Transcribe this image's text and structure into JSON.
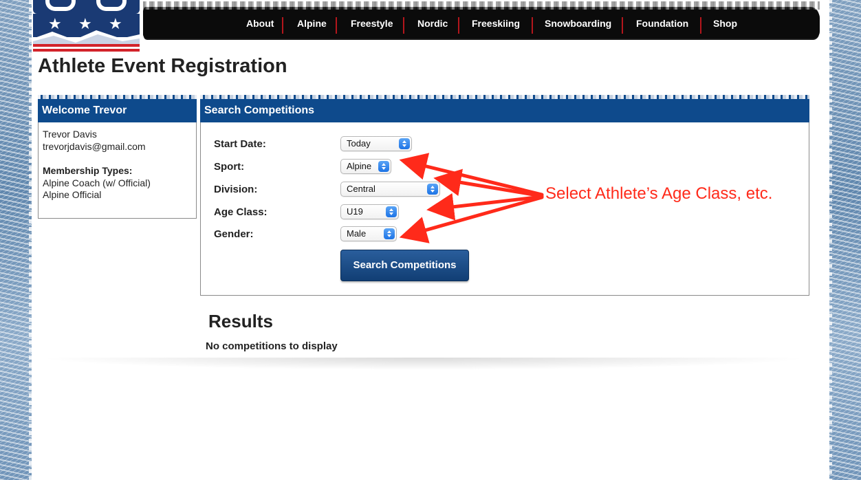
{
  "nav": {
    "items": [
      "About",
      "Alpine",
      "Freestyle",
      "Nordic",
      "Freeskiing",
      "Snowboarding",
      "Foundation",
      "Shop"
    ]
  },
  "page": {
    "title": "Athlete Event Registration"
  },
  "welcome": {
    "header": "Welcome Trevor",
    "name": "Trevor  Davis",
    "email": "trevorjdavis@gmail.com",
    "membership_label": "Membership Types:",
    "membership_types": [
      "Alpine Coach (w/ Official)",
      "Alpine Official"
    ]
  },
  "search": {
    "header": "Search Competitions",
    "fields": [
      {
        "label": "Start Date:",
        "value": "Today"
      },
      {
        "label": "Sport:",
        "value": "Alpine"
      },
      {
        "label": "Division:",
        "value": "Central"
      },
      {
        "label": "Age Class:",
        "value": "U19"
      },
      {
        "label": "Gender:",
        "value": "Male"
      }
    ],
    "button_label": "Search Competitions"
  },
  "results": {
    "title": "Results",
    "empty_message": "No competitions to display"
  },
  "annotation": {
    "text": "Select Athlete’s Age Class, etc.",
    "color": "#ff2a1a"
  },
  "colors": {
    "panel_header": "#0e4a8c",
    "button": "#1a4b85",
    "nav_bg": "#0b0b0b",
    "nav_separator": "#b3161c"
  },
  "logo": {
    "icons": [
      "star-icon",
      "star-icon",
      "star-icon"
    ]
  }
}
